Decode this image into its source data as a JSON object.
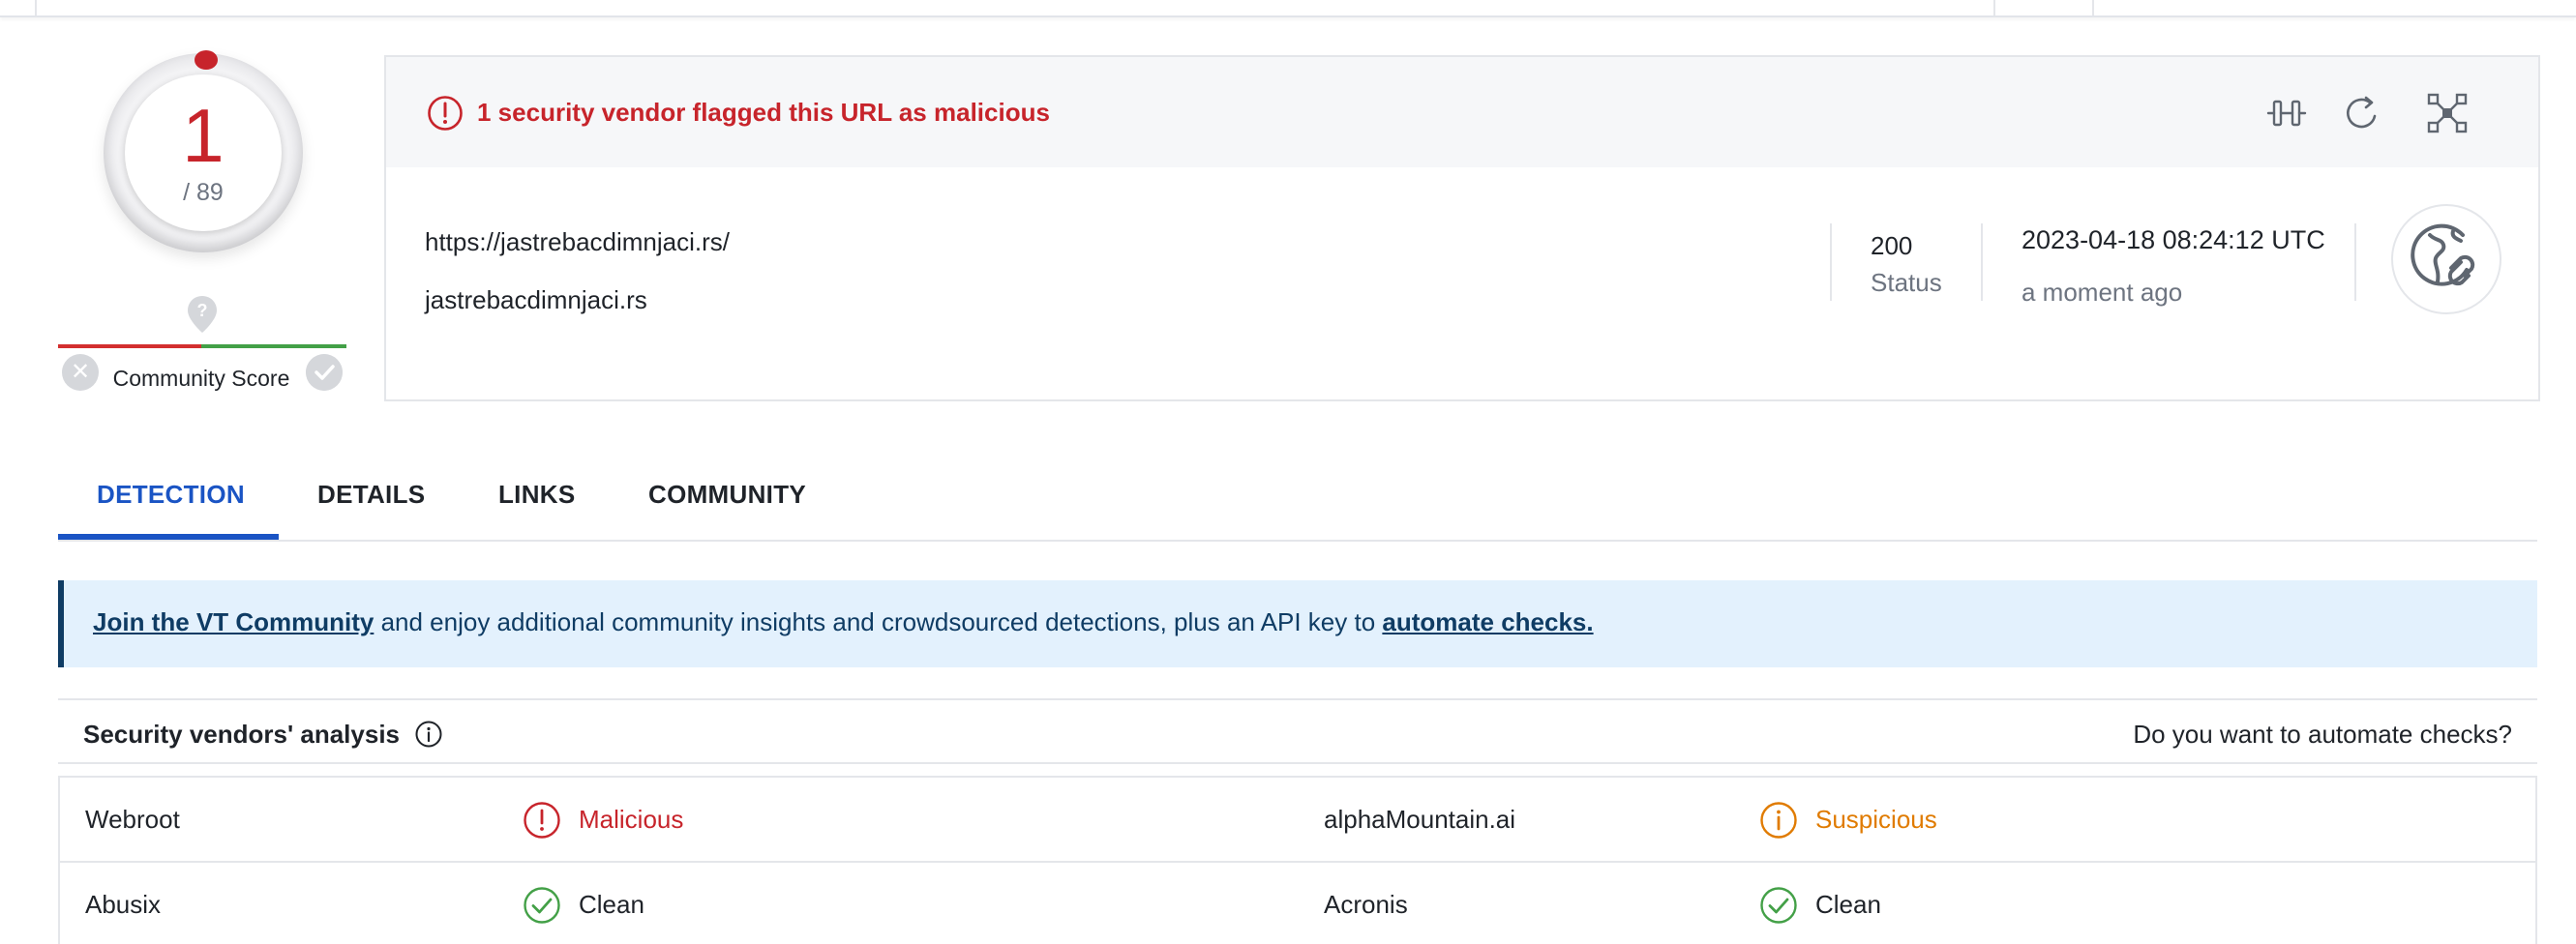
{
  "score": {
    "detections": "1",
    "total": "/ 89",
    "community_label": "Community Score"
  },
  "alert": {
    "text": "1 security vendor flagged this URL as malicious"
  },
  "summary": {
    "url": "https://jastrebacdimnjaci.rs/",
    "domain": "jastrebacdimnjaci.rs",
    "status_code": "200",
    "status_label": "Status",
    "date": "2023-04-18 08:24:12 UTC",
    "relative_time": "a moment ago"
  },
  "tabs": [
    {
      "label": "DETECTION",
      "active": true
    },
    {
      "label": "DETAILS",
      "active": false
    },
    {
      "label": "LINKS",
      "active": false
    },
    {
      "label": "COMMUNITY",
      "active": false
    }
  ],
  "banner": {
    "link1": "Join the VT Community",
    "middle": " and enjoy additional community insights and crowdsourced detections, plus an API key to ",
    "link2": "automate checks."
  },
  "analysis": {
    "title": "Security vendors' analysis",
    "automate_question": "Do you want to automate checks?"
  },
  "vendors": [
    [
      {
        "name": "Webroot",
        "verdict": "Malicious",
        "kind": "malicious"
      },
      {
        "name": "alphaMountain.ai",
        "verdict": "Suspicious",
        "kind": "suspicious"
      }
    ],
    [
      {
        "name": "Abusix",
        "verdict": "Clean",
        "kind": "clean"
      },
      {
        "name": "Acronis",
        "verdict": "Clean",
        "kind": "clean"
      }
    ]
  ],
  "colors": {
    "malicious": "#c7242b",
    "suspicious": "#e07b00",
    "clean_icon": "#43a047",
    "accent": "#1a54c4",
    "banner_text": "#0f3c64"
  }
}
